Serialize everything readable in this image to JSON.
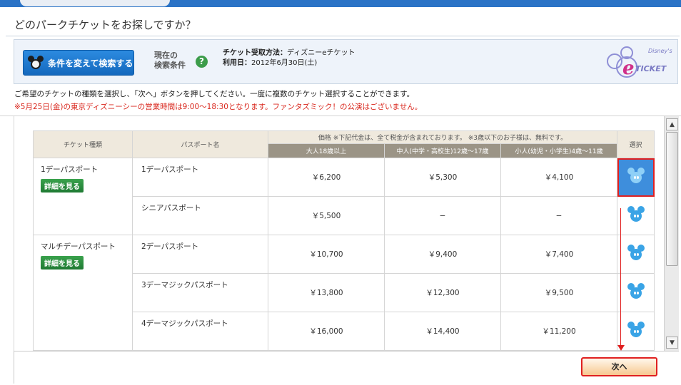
{
  "page": {
    "title": "どのパークチケットをお探しですか？"
  },
  "conditions": {
    "search_button_label": "条件を変えて検索する",
    "current_label_line1": "現在の",
    "current_label_line2": "検索条件",
    "help_glyph": "?",
    "method_label": "チケット受取方法：",
    "method_value": "ディズニーeチケット",
    "date_label": "利用日：",
    "date_value": "2012年6月30日(土)",
    "logo_text_top": "Disney's",
    "logo_text_main": "TICKET",
    "logo_text_e": "e"
  },
  "instruction": "ご希望のチケットの種類を選択し、「次へ」ボタンを押してください。一度に複数のチケット選択することができます。",
  "notice": "※5月25日(金)の東京ディズニーシーの営業時間は9:00〜18:30となります。ファンタズミック！の公演はございません。",
  "table": {
    "headers": {
      "type": "チケット種類",
      "pass": "パスポート名",
      "price": "価格 ※下記代金は、全て税金が含まれております。 ※3歳以下のお子様は、無料です。",
      "select": "選択",
      "adult": "大人18歳以上",
      "junior": "中人(中学・高校生)12歳〜17歳",
      "child": "小人(幼児・小学生)4歳〜11歳"
    },
    "detail_button_label": "詳細を見る",
    "groups": [
      {
        "type": "1デーパスポート",
        "rows": [
          {
            "pass": "1デーパスポート",
            "adult": "￥6,200",
            "junior": "￥5,300",
            "child": "￥4,100"
          },
          {
            "pass": "シニアパスポート",
            "adult": "￥5,500",
            "junior": "−",
            "child": "−"
          }
        ]
      },
      {
        "type": "マルチデーパスポート",
        "rows": [
          {
            "pass": "2デーパスポート",
            "adult": "￥10,700",
            "junior": "￥9,400",
            "child": "￥7,400"
          },
          {
            "pass": "3デーマジックパスポート",
            "adult": "￥13,800",
            "junior": "￥12,300",
            "child": "￥9,500"
          },
          {
            "pass": "4デーマジックパスポート",
            "adult": "￥16,000",
            "junior": "￥14,400",
            "child": "￥11,200"
          }
        ]
      }
    ]
  },
  "scrollbar": {
    "up_glyph": "▲",
    "down_glyph": "▼"
  },
  "footer": {
    "next_button_label": "次へ"
  },
  "colors": {
    "accent_blue": "#2b73c6",
    "notice_red": "#d9261c",
    "highlight_red": "#e02020",
    "selected_cell": "#3e8edc",
    "detail_green": "#2a8c3e"
  }
}
